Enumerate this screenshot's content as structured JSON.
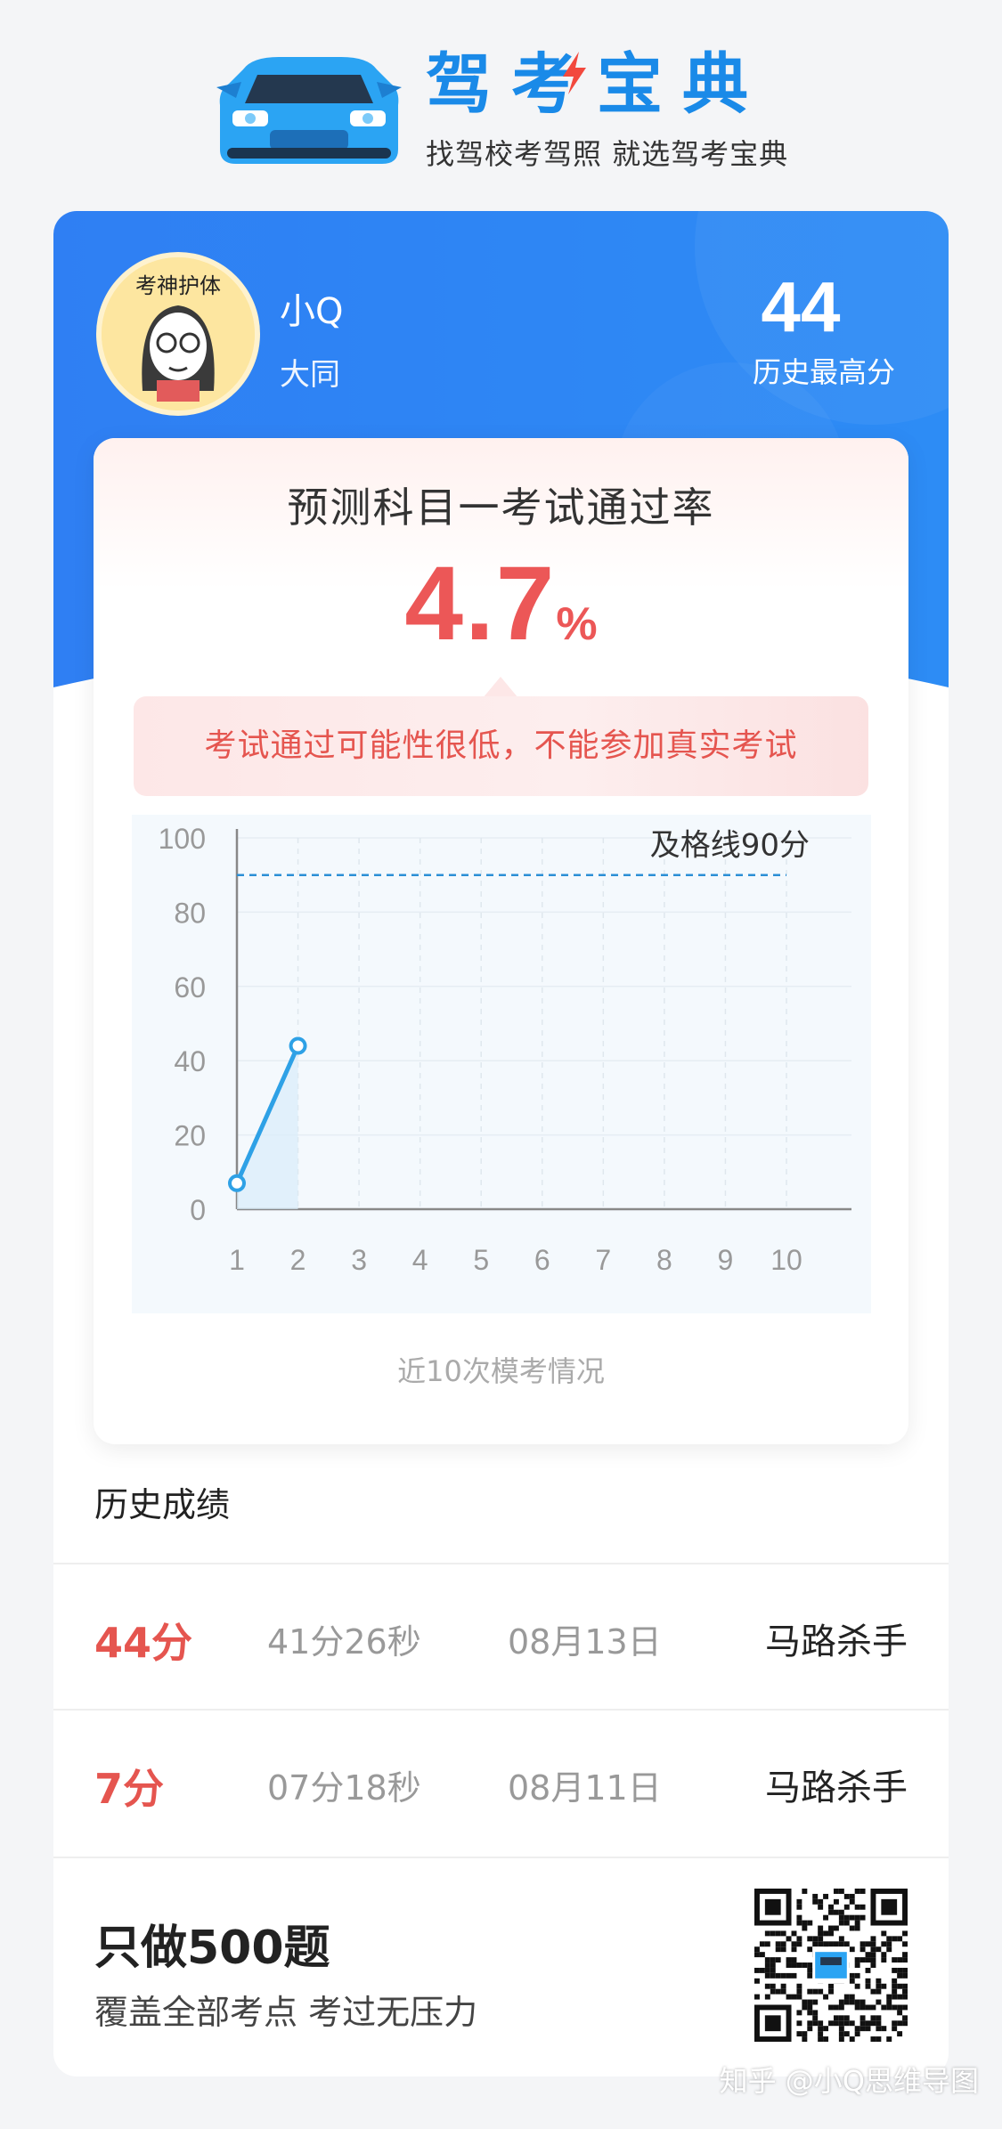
{
  "brand": {
    "title": "驾考宝典",
    "slogan": "找驾校考驾照 就选驾考宝典"
  },
  "user": {
    "name": "小Q",
    "city": "大同",
    "best_score": "44",
    "best_score_label": "历史最高分",
    "avatar_text": "考神护体"
  },
  "prediction": {
    "title": "预测科目一考试通过率",
    "rate": "4.7",
    "rate_unit": "%",
    "warning": "考试通过可能性很低，不能参加真实考试"
  },
  "chart_data": {
    "type": "line",
    "x": [
      1,
      2,
      3,
      4,
      5,
      6,
      7,
      8,
      9,
      10
    ],
    "series": [
      {
        "values": [
          7,
          44
        ]
      }
    ],
    "xlim": [
      1,
      10
    ],
    "ylim": [
      0,
      100
    ],
    "yticks": [
      0,
      20,
      40,
      60,
      80,
      100
    ],
    "reference_line": {
      "value": 90,
      "label": "及格线90分"
    },
    "caption": "近10次模考情况",
    "grid": true
  },
  "history": {
    "title": "历史成绩",
    "rows": [
      {
        "score": "44分",
        "duration": "41分26秒",
        "date": "08月13日",
        "title": "马路杀手"
      },
      {
        "score": "7分",
        "duration": "07分18秒",
        "date": "08月11日",
        "title": "马路杀手"
      }
    ]
  },
  "promo": {
    "title": "只做500题",
    "subtitle": "覆盖全部考点 考过无压力"
  },
  "watermark": "知乎 @小Q思维导图",
  "colors": {
    "brand_blue": "#1a8ae8",
    "header_blue": "#2f80f2",
    "alert_red": "#ec5757",
    "chart_line": "#2ea1e6"
  }
}
